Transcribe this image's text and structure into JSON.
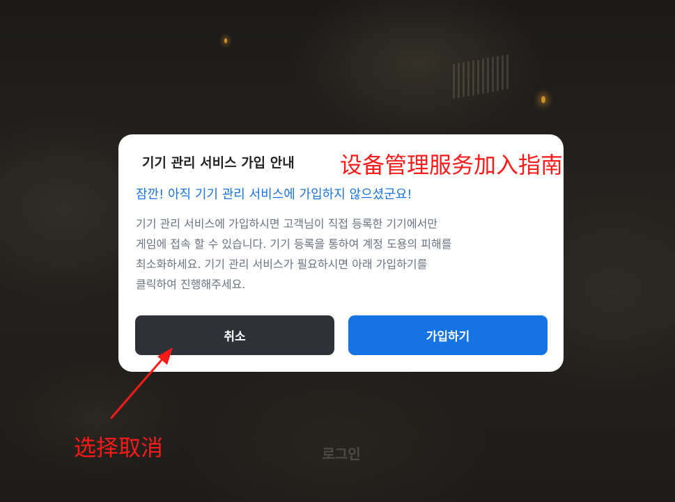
{
  "dialog": {
    "title": "기기 관리 서비스 가입 안내",
    "alert": "잠깐! 아직 기기 관리 서비스에 가입하지 않으셨군요!",
    "body_lines": [
      "기기 관리 서비스에 가입하시면 고객님이 직접 등록한 기기에서만",
      "게임에 접속 할 수 있습니다. 기기 등록을 통하여 계정 도용의 피해를",
      "최소화하세요. 기기 관리 서비스가 필요하시면 아래 가입하기를",
      "클릭하여 진행해주세요."
    ],
    "cancel_label": "취소",
    "join_label": "가입하기"
  },
  "background": {
    "login_label": "로그인"
  },
  "annotations": {
    "title_note": "设备管理服务加入指南",
    "cancel_note": "选择取消",
    "color": "#ff1a1a"
  },
  "colors": {
    "accent_blue": "#1673e3",
    "cancel_dark": "#2f3138",
    "alert_blue": "#1a73e0"
  }
}
